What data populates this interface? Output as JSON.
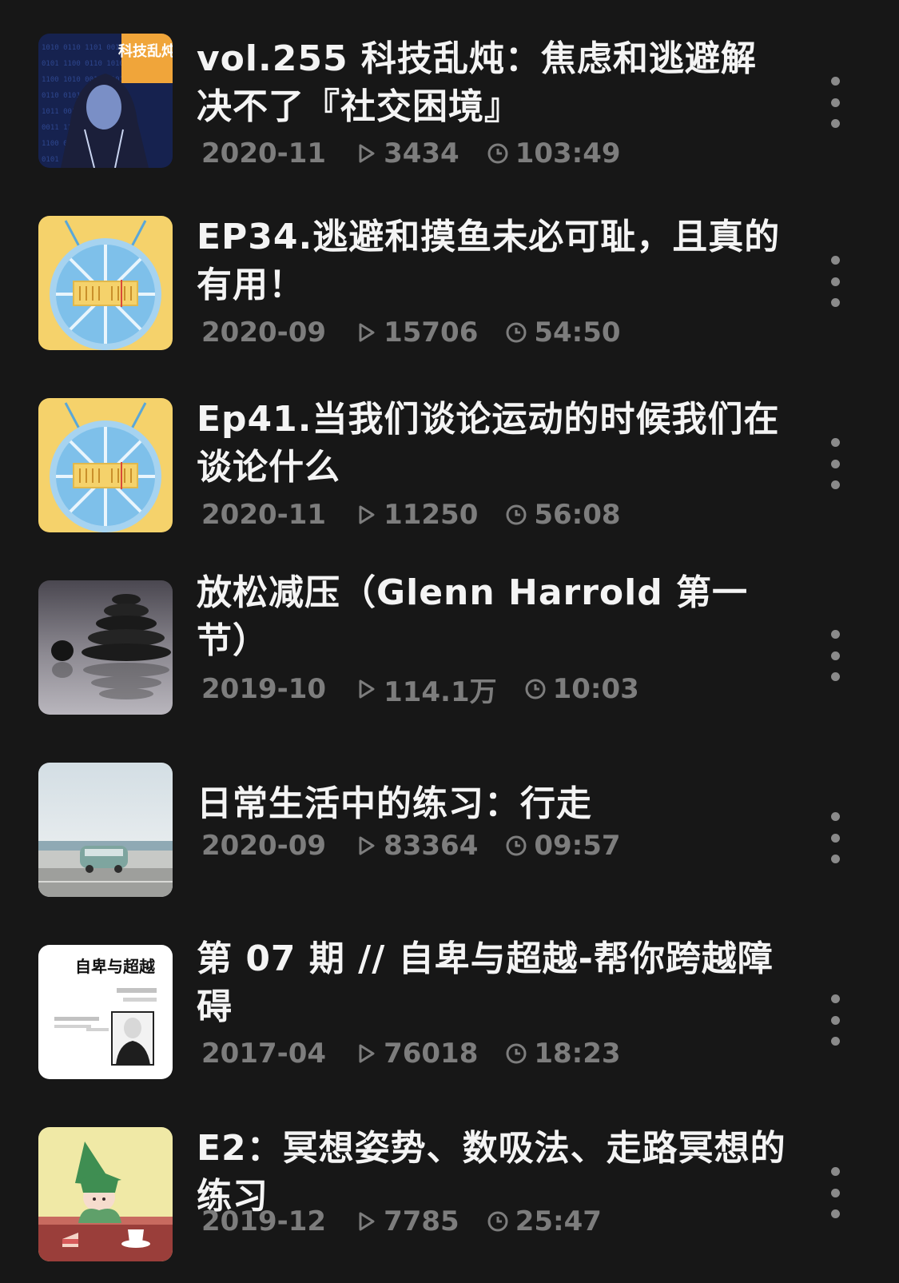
{
  "episodes": [
    {
      "title": "vol.255 科技乱炖：焦虑和逃避解决不了『社交困境』",
      "date": "2020-11",
      "plays": "3434",
      "duration": "103:49",
      "cover_icon": "hooded-figure-cover",
      "cover_text": "科技乱炖"
    },
    {
      "title": "EP34.逃避和摸鱼未必可耻，且真的有用！",
      "date": "2020-09",
      "plays": "15706",
      "duration": "54:50",
      "cover_icon": "lemon-radio-cover"
    },
    {
      "title": "Ep41.当我们谈论运动的时候我们在谈论什么",
      "date": "2020-11",
      "plays": "11250",
      "duration": "56:08",
      "cover_icon": "lemon-radio-cover"
    },
    {
      "title": "放松减压（Glenn Harrold 第一节）",
      "date": "2019-10",
      "plays": "114.1万",
      "duration": "10:03",
      "cover_icon": "stacked-stones-cover"
    },
    {
      "title": "日常生活中的练习：行走",
      "date": "2020-09",
      "plays": "83364",
      "duration": "09:57",
      "cover_icon": "van-by-sea-cover"
    },
    {
      "title": "第 07 期 // 自卑与超越-帮你跨越障碍",
      "date": "2017-04",
      "plays": "76018",
      "duration": "18:23",
      "cover_icon": "book-cover",
      "cover_text": "自卑与超越"
    },
    {
      "title": "E2：冥想姿势、数吸法、走路冥想的练习",
      "date": "2019-12",
      "plays": "7785",
      "duration": "25:47",
      "cover_icon": "illustration-cover"
    }
  ],
  "colors": {
    "background": "#171717",
    "title": "#f4f4f4",
    "meta": "#7d7d7d",
    "more_dots": "#8a8a8a"
  },
  "icons": {
    "plays": "play-icon",
    "duration": "clock-icon",
    "more": "more-vertical-icon"
  }
}
